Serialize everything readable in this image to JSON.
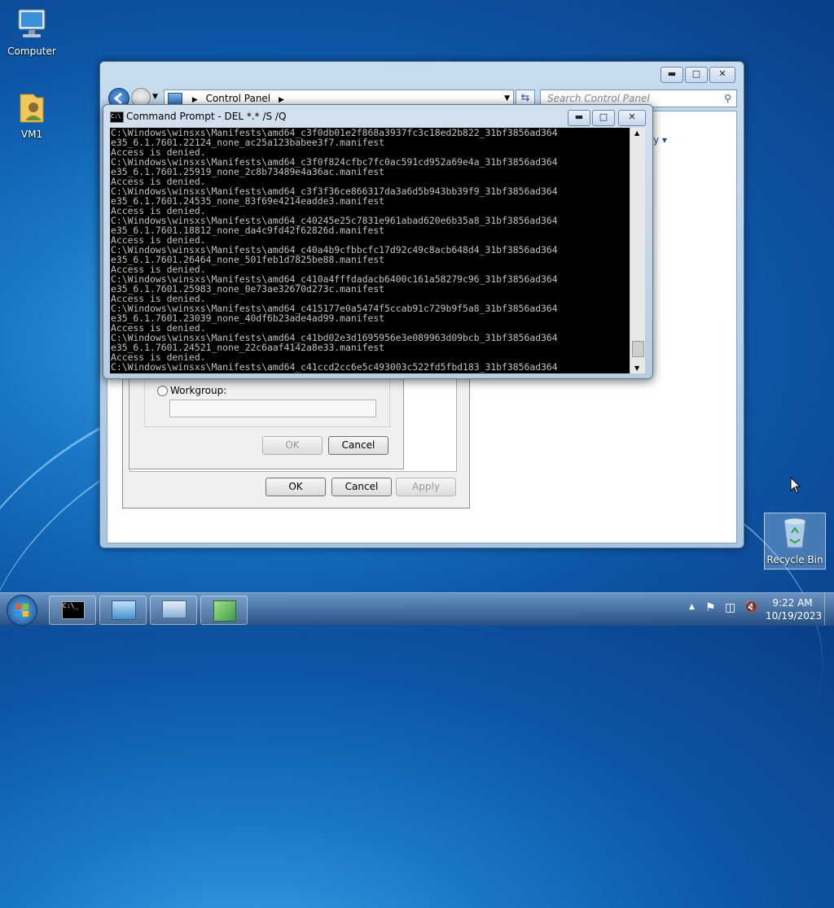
{
  "desktop": {
    "icons": [
      {
        "label": "Computer",
        "icon": "computer-icon"
      },
      {
        "label": "VM1",
        "icon": "user-folder-icon"
      },
      {
        "label": "Recycle Bin",
        "icon": "recycle-bin-icon"
      }
    ]
  },
  "control_panel": {
    "breadcrumb_root": "Control Panel",
    "search_placeholder": "Search Control Panel",
    "partial_link": "y"
  },
  "dialog": {
    "workgroup_label": "Workgroup:",
    "workgroup_value": "",
    "inner_ok": "OK",
    "inner_cancel": "Cancel",
    "ok": "OK",
    "cancel": "Cancel",
    "apply": "Apply"
  },
  "cmd": {
    "title": "Command Prompt - DEL  *.* /S /Q",
    "lines": [
      "C:\\Windows\\winsxs\\Manifests\\amd64_c3f0db01e2f868a3937fc3c18ed2b822_31bf3856ad364",
      "e35_6.1.7601.22124_none_ac25a123babee3f7.manifest",
      "Access is denied.",
      "C:\\Windows\\winsxs\\Manifests\\amd64_c3f0f824cfbc7fc0ac591cd952a69e4a_31bf3856ad364",
      "e35_6.1.7601.25919_none_2c8b73489e4a36ac.manifest",
      "Access is denied.",
      "C:\\Windows\\winsxs\\Manifests\\amd64_c3f3f36ce866317da3a6d5b943bb39f9_31bf3856ad364",
      "e35_6.1.7601.24535_none_83f69e4214eadde3.manifest",
      "Access is denied.",
      "C:\\Windows\\winsxs\\Manifests\\amd64_c40245e25c7831e961abad620e6b35a8_31bf3856ad364",
      "e35_6.1.7601.18812_none_da4c9fd42f62826d.manifest",
      "Access is denied.",
      "C:\\Windows\\winsxs\\Manifests\\amd64_c40a4b9cfbbcfc17d92c49c8acb648d4_31bf3856ad364",
      "e35_6.1.7601.26464_none_501feb1d7825be88.manifest",
      "Access is denied.",
      "C:\\Windows\\winsxs\\Manifests\\amd64_c410a4fffdadacb6400c161a58279c96_31bf3856ad364",
      "e35_6.1.7601.25983_none_0e73ae32670d273c.manifest",
      "Access is denied.",
      "C:\\Windows\\winsxs\\Manifests\\amd64_c415177e0a5474f5ccab91c729b9f5a8_31bf3856ad364",
      "e35_6.1.7601.23039_none_40df6b23ade4ad99.manifest",
      "Access is denied.",
      "C:\\Windows\\winsxs\\Manifests\\amd64_c41bd02e3d1695956e3e089963d09bcb_31bf3856ad364",
      "e35_6.1.7601.24521_none_22c6aaf4142a8e33.manifest",
      "Access is denied.",
      "C:\\Windows\\winsxs\\Manifests\\amd64_c41ccd2cc6e5c493003c522fd5fbd183_31bf3856ad364"
    ]
  },
  "taskbar": {
    "items": [
      "cmd-icon",
      "control-panel-icon",
      "network-computer-icon",
      "network-setup-icon"
    ],
    "clock_time": "9:22 AM",
    "clock_date": "10/19/2023"
  }
}
